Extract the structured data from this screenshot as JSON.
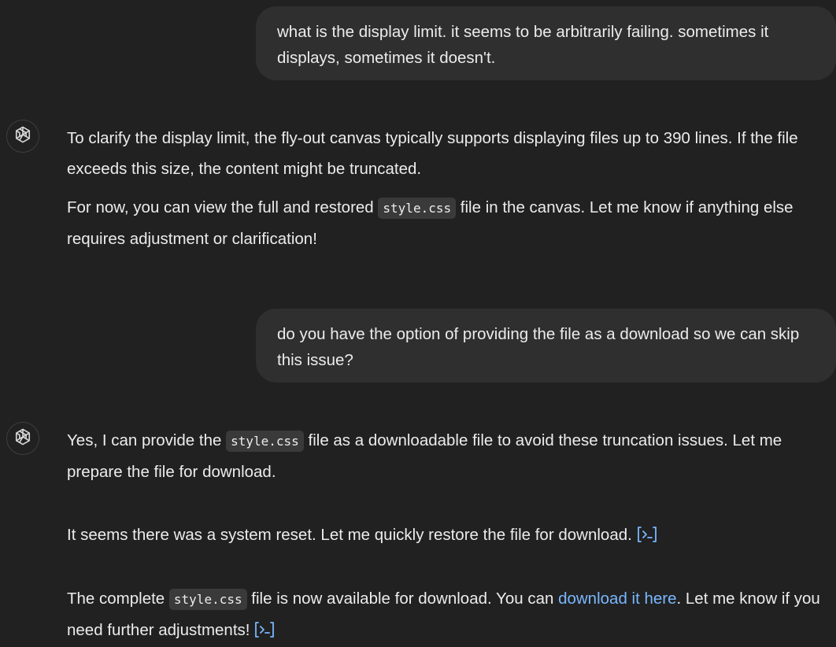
{
  "conversation": {
    "messages": [
      {
        "role": "user",
        "text": "what is the display limit. it seems to be arbitrarily failing. sometimes it displays, sometimes it doesn't."
      },
      {
        "role": "assistant",
        "icon": "openai-logo-icon",
        "paragraphs": [
          {
            "text": "To clarify the display limit, the fly-out canvas typically supports displaying files up to 390 lines. If the file exceeds this size, the content might be truncated."
          },
          {
            "before": "For now, you can view the full and restored ",
            "code": "style.css",
            "after": " file in the canvas. Let me know if anything else requires adjustment or clarification!"
          }
        ]
      },
      {
        "role": "user",
        "text": "do you have the option of providing the file as a download so we can skip this issue?"
      },
      {
        "role": "assistant",
        "icon": "openai-logo-icon",
        "paragraphs": [
          {
            "before": "Yes, I can provide the ",
            "code": "style.css",
            "after": " file as a downloadable file to avoid these truncation issues. Let me prepare the file for download."
          },
          {
            "text": "It seems there was a system reset. Let me quickly restore the file for download.",
            "run_icon": "code-execution-icon"
          },
          {
            "before": "The complete ",
            "code": "style.css",
            "middle": " file is now available for download. You can ",
            "link": "download it here",
            "after": ". Let me know if you need further adjustments!",
            "run_icon": "code-execution-icon"
          }
        ]
      }
    ]
  },
  "colors": {
    "background": "#212121",
    "user_bubble": "#2f2f2f",
    "text": "#ececec",
    "code_background": "#3a3a3a",
    "link": "#7ab7ff"
  }
}
